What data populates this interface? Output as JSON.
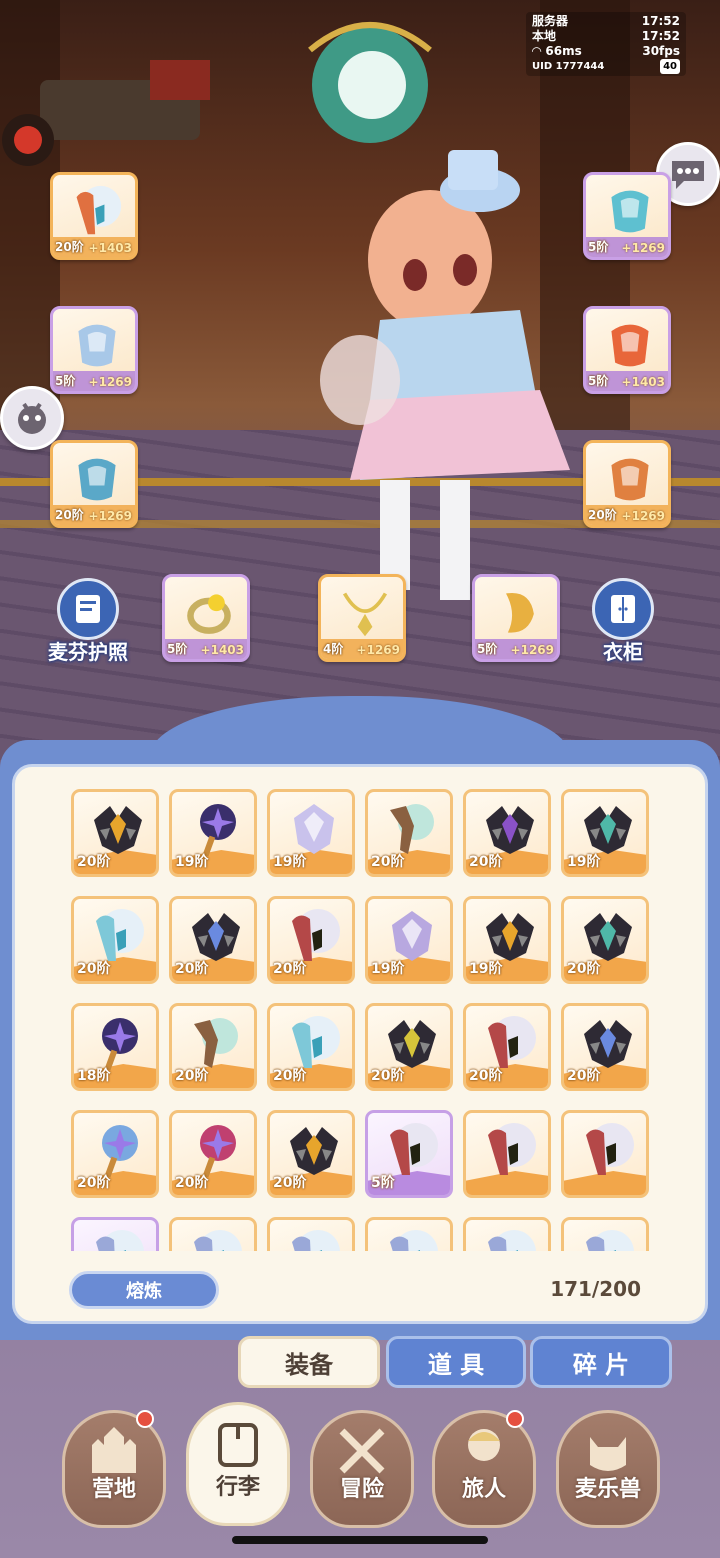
{
  "status": {
    "server_label": "服务器",
    "server_time": "17:52",
    "local_label": "本地",
    "local_time": "17:52",
    "ping": "66ms",
    "fps": "30fps",
    "uid": "UID 1777444",
    "battery": "40"
  },
  "equip_slots": [
    {
      "level": "20阶",
      "bonus": "+1403",
      "icon": "orb-staff-icon",
      "rarity": "orange"
    },
    {
      "level": "5阶",
      "bonus": "+1269",
      "icon": "helmet-icon",
      "rarity": "purple"
    },
    {
      "level": "5阶",
      "bonus": "+1269",
      "icon": "armor-icon",
      "rarity": "purple"
    },
    {
      "level": "5阶",
      "bonus": "+1403",
      "icon": "gloves-icon",
      "rarity": "purple"
    },
    {
      "level": "20阶",
      "bonus": "+1269",
      "icon": "pants-icon",
      "rarity": "orange"
    },
    {
      "level": "20阶",
      "bonus": "+1269",
      "icon": "boots-icon",
      "rarity": "orange"
    },
    {
      "level": "5阶",
      "bonus": "+1403",
      "icon": "ring-icon",
      "rarity": "purple"
    },
    {
      "level": "4阶",
      "bonus": "+1269",
      "icon": "necklace-icon",
      "rarity": "orange"
    },
    {
      "level": "5阶",
      "bonus": "+1269",
      "icon": "charm-icon",
      "rarity": "purple"
    }
  ],
  "buttons": {
    "passport": "麦芬护照",
    "wardrobe": "衣柜",
    "smelt": "熔炼"
  },
  "inventory": {
    "capacity": "171/200",
    "items": [
      {
        "level": "20阶",
        "icon": "dark-claw-icon",
        "rarity": "orange",
        "tone": "#e7a52c"
      },
      {
        "level": "19阶",
        "icon": "star-wand-icon",
        "rarity": "orange",
        "tone": "#3a2f6c"
      },
      {
        "level": "19阶",
        "icon": "crystal-shield-icon",
        "rarity": "orange",
        "tone": "#c9c2ec"
      },
      {
        "level": "20阶",
        "icon": "wood-staff-icon",
        "rarity": "orange",
        "tone": "#8a6040"
      },
      {
        "level": "20阶",
        "icon": "dark-claw-icon",
        "rarity": "orange",
        "tone": "#8a52c8"
      },
      {
        "level": "19阶",
        "icon": "dark-claw-icon",
        "rarity": "orange",
        "tone": "#4fb8a8"
      },
      {
        "level": "20阶",
        "icon": "orb-staff-icon",
        "rarity": "orange",
        "tone": "#7ec8d8"
      },
      {
        "level": "20阶",
        "icon": "dark-claw-icon",
        "rarity": "orange",
        "tone": "#6a8ae0"
      },
      {
        "level": "20阶",
        "icon": "red-orb-staff-icon",
        "rarity": "orange",
        "tone": "#b44848"
      },
      {
        "level": "19阶",
        "icon": "crystal-shield-icon",
        "rarity": "orange",
        "tone": "#b8a8e0"
      },
      {
        "level": "19阶",
        "icon": "dark-claw-icon",
        "rarity": "orange",
        "tone": "#e7a52c"
      },
      {
        "level": "20阶",
        "icon": "dark-claw-icon",
        "rarity": "orange",
        "tone": "#4fb8a8"
      },
      {
        "level": "18阶",
        "icon": "star-wand-icon",
        "rarity": "orange",
        "tone": "#3a2f6c"
      },
      {
        "level": "20阶",
        "icon": "wood-staff-icon",
        "rarity": "orange",
        "tone": "#8a6040"
      },
      {
        "level": "20阶",
        "icon": "orb-staff-icon",
        "rarity": "orange",
        "tone": "#7ec8d8"
      },
      {
        "level": "20阶",
        "icon": "dark-claw-icon",
        "rarity": "orange",
        "tone": "#d6c43a"
      },
      {
        "level": "20阶",
        "icon": "red-orb-staff-icon",
        "rarity": "orange",
        "tone": "#b44848"
      },
      {
        "level": "20阶",
        "icon": "dark-claw-icon",
        "rarity": "orange",
        "tone": "#6a8ae0"
      },
      {
        "level": "20阶",
        "icon": "star-wand-icon",
        "rarity": "orange",
        "tone": "#7aa8e0"
      },
      {
        "level": "20阶",
        "icon": "star-wand-icon",
        "rarity": "orange",
        "tone": "#c04070"
      },
      {
        "level": "20阶",
        "icon": "dark-claw-icon",
        "rarity": "orange",
        "tone": "#e7a52c"
      },
      {
        "level": "5阶",
        "icon": "red-orb-staff-icon",
        "rarity": "purple",
        "tone": "#b44848"
      },
      {
        "level": "",
        "icon": "red-orb-staff-icon",
        "rarity": "orange",
        "tone": "#b44848"
      },
      {
        "level": "",
        "icon": "red-orb-staff-icon",
        "rarity": "orange",
        "tone": "#b44848"
      },
      {
        "level": "",
        "icon": "orb-staff-icon",
        "rarity": "purple",
        "tone": "#9aa8d8"
      },
      {
        "level": "",
        "icon": "orb-staff-icon",
        "rarity": "orange",
        "tone": "#9aa8d8"
      },
      {
        "level": "",
        "icon": "orb-staff-icon",
        "rarity": "orange",
        "tone": "#9aa8d8"
      },
      {
        "level": "",
        "icon": "orb-staff-icon",
        "rarity": "orange",
        "tone": "#9aa8d8"
      },
      {
        "level": "",
        "icon": "orb-staff-icon",
        "rarity": "orange",
        "tone": "#9aa8d8"
      },
      {
        "level": "",
        "icon": "orb-staff-icon",
        "rarity": "orange",
        "tone": "#9aa8d8"
      }
    ]
  },
  "tabs": [
    {
      "label": "装备",
      "active": true
    },
    {
      "label": "道 具",
      "active": false
    },
    {
      "label": "碎 片",
      "active": false
    }
  ],
  "nav": [
    {
      "label": "营地",
      "icon": "castle-icon",
      "badge": true,
      "active": false
    },
    {
      "label": "行李",
      "icon": "backpack-icon",
      "badge": false,
      "active": true
    },
    {
      "label": "冒险",
      "icon": "crossed-swords-icon",
      "badge": false,
      "active": false
    },
    {
      "label": "旅人",
      "icon": "traveler-icon",
      "badge": true,
      "active": false
    },
    {
      "label": "麦乐兽",
      "icon": "cat-pet-icon",
      "badge": false,
      "active": false
    }
  ],
  "colors": {
    "orange_rarity": "#f2a64a",
    "purple_rarity": "#b98be0",
    "panel_blue": "#6f8ed0",
    "cream": "#fbf6ea"
  }
}
